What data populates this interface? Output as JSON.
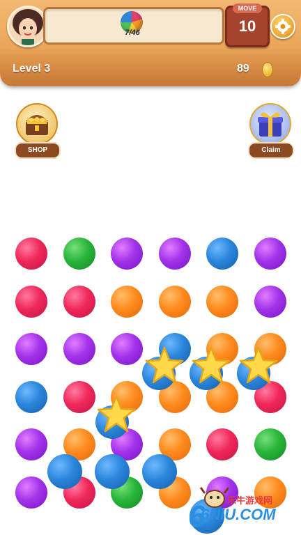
{
  "hud": {
    "goal_progress": "7/46",
    "move_label": "MOVE",
    "moves": "10",
    "level": "Level 3",
    "coins": "89"
  },
  "side": {
    "shop_label": "SHOP",
    "claim_label": "Claim"
  },
  "board": {
    "rows": [
      [
        "red",
        "green",
        "purple",
        "purple",
        "blue",
        "purple"
      ],
      [
        "red",
        "red",
        "orange",
        "orange",
        "orange",
        "purple"
      ],
      [
        "purple",
        "purple",
        "purple",
        "blue",
        "orange",
        "orange"
      ],
      [
        "blue",
        "red",
        "orange",
        "orange",
        "orange",
        "red"
      ],
      [
        "purple",
        "orange",
        "purple",
        "orange",
        "red",
        "green"
      ],
      [
        "purple",
        "red",
        "green",
        "orange",
        "purple",
        "orange"
      ]
    ]
  },
  "watermark": {
    "text": "乐牛游戏网",
    "brand": "6NIU.COM"
  }
}
